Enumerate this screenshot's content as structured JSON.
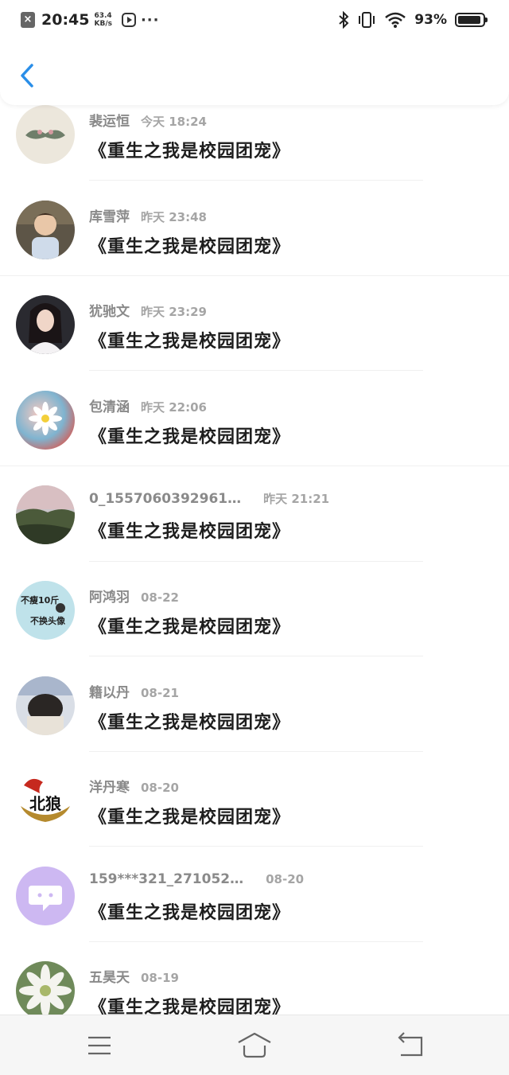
{
  "status_bar": {
    "time": "20:45",
    "net_speed_value": "63.4",
    "net_speed_unit": "KB/s",
    "more": "···",
    "battery_percent": "93%",
    "battery_level": 0.93
  },
  "header": {
    "back_icon": "chevron-left-icon",
    "accent_color": "#2a8ee8"
  },
  "comments": [
    {
      "author": "裴运恒",
      "time": "今天 18:24",
      "text": "《重生之我是校园团宠》",
      "avatar": "mustache-avatar"
    },
    {
      "author": "库雪萍",
      "time": "昨天 23:48",
      "text": "《重生之我是校园团宠》",
      "avatar": "child-photo-avatar"
    },
    {
      "author": "犹驰文",
      "time": "昨天 23:29",
      "text": "《重生之我是校园团宠》",
      "avatar": "girl-photo-avatar"
    },
    {
      "author": "包清涵",
      "time": "昨天 22:06",
      "text": "《重生之我是校园团宠》",
      "avatar": "daisy-blue-avatar"
    },
    {
      "author": "0_1557060392961…",
      "time": "昨天 21:21",
      "text": "《重生之我是校园团宠》",
      "avatar": "landscape-avatar"
    },
    {
      "author": "阿鸿羽",
      "time": "08-22",
      "text": "《重生之我是校园团宠》",
      "avatar": "text-sticker-avatar",
      "avatar_text_1": "不瘦10斤",
      "avatar_text_2": "不换头像"
    },
    {
      "author": "籍以丹",
      "time": "08-21",
      "text": "《重生之我是校园团宠》",
      "avatar": "hat-girl-avatar"
    },
    {
      "author": "洋丹寒",
      "time": "08-20",
      "text": "《重生之我是校园团宠》",
      "avatar": "wolf-logo-avatar",
      "avatar_text_1": "北狼"
    },
    {
      "author": "159***321_271052…",
      "time": "08-20",
      "text": "《重生之我是校园团宠》",
      "avatar": "chat-bubble-avatar"
    },
    {
      "author": "五昊天",
      "time": "08-19",
      "text": "《重生之我是校园团宠》",
      "avatar": "white-flower-avatar"
    }
  ],
  "nav_bar": {
    "menu_icon": "menu-icon",
    "home_icon": "home-icon",
    "back_icon": "return-icon"
  }
}
